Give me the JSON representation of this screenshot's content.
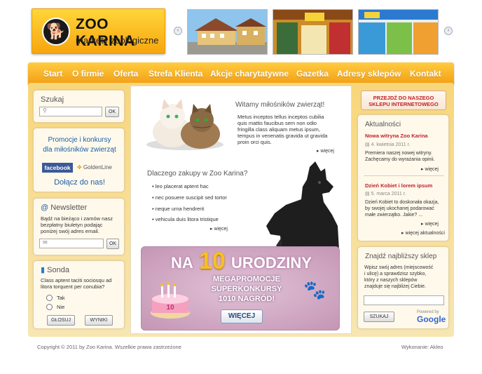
{
  "logo": {
    "name": "ZOO KARINA",
    "tagline": "markety zoologiczne"
  },
  "carousel": {
    "prev": "‹",
    "next": "›"
  },
  "nav": [
    "Start",
    "O firmie",
    "Oferta",
    "Strefa Klienta",
    "Akcje charytatywne",
    "Gazetka",
    "Adresy sklepów",
    "Kontakt"
  ],
  "search": {
    "title": "Szukaj",
    "button": "OK"
  },
  "promo": {
    "title_line1": "Promocje i konkursy",
    "title_line2": "dla miłośników zwierząt",
    "facebook": "facebook",
    "goldenline": "GoldenLine",
    "join": "Dołącz do nas!"
  },
  "newsletter": {
    "title": "Newsletter",
    "text_line1": "Bądź na bieżąco i zamów nasz",
    "text_line2": "bezpłatny biuletyn podając",
    "text_line3": "poniżej swój adres email.",
    "button": "OK"
  },
  "poll": {
    "title": "Sonda",
    "question_line1": "Class aptent taciti sociosqu ad",
    "question_line2": "litora torquent per conubia?",
    "option1": "Tak",
    "option2": "Nie",
    "vote": "GŁOSUJ",
    "results": "WYNIKI"
  },
  "welcome": {
    "title": "Witamy miłośników zwierząt!",
    "line1": "Metus inceptos tellus inceptos cubilia",
    "line2": "quis mattis faucibus sem non odio",
    "line3": "fringilla class aliquam metus ipsum,",
    "line4": "tempus in venenatis gravida ut gravida",
    "line5": "proin orci quis.",
    "more": "więcej"
  },
  "why": {
    "title": "Dlaczego zakupy w Zoo Karina?",
    "items": [
      "leo placerat aptent hac",
      "nec posuere suscipit sed tortor",
      "neque urna hendrerit",
      "vehicula duis litora tristique"
    ],
    "more": "więcej"
  },
  "banner": {
    "na": "NA",
    "num": "10",
    "urodziny": "URODZINY",
    "l1": "MEGAPROMOCJE",
    "l2": "SUPERKONKURSY",
    "l3": "1010 NAGRÓD!",
    "button": "WIĘCEJ",
    "cake_topper": "10"
  },
  "shop_btn": {
    "line1": "PRZEJDŹ DO NASZEGO",
    "line2": "SKLEPU INTERNETOWEGO"
  },
  "news": {
    "title": "Aktualności",
    "items": [
      {
        "title": "Nowa witryna Zoo Karina",
        "date": "4. kwietnia 2011 r.",
        "line1": "Premiera naszej nowej witryny.",
        "line2": "Zachęcamy do wyrażania opinii.",
        "more": "więcej"
      },
      {
        "title": "Dzień Kobiet i lorem ipsum",
        "date": "5. marca 2011 r.",
        "line1": "Dzień Kobiet to doskonała okazja,",
        "line2": "by swojej ukochanej podarować",
        "line3": "małe zwierzątko. Jakie? ...",
        "more": "więcej"
      }
    ],
    "all": "więcej aktualności"
  },
  "finder": {
    "title": "Znajdź najbliższy sklep",
    "line1": "Wpisz swój adres (miejscowość",
    "line2": "i ulicę) a sprawdzisz szybko,",
    "line3": "który z naszych sklepów",
    "line4": "znajduje się najbliżej Ciebie.",
    "button": "SZUKAJ",
    "powered": "Powered by",
    "google": "Google"
  },
  "footer": {
    "copyright": "Copyright © 2011 by Zoo Karina. Wszelkie prawa zastrzeżone",
    "credit": "Wykonanie: Akleo"
  },
  "colors": {
    "orange": "#f7a50e",
    "news_red": "#c0212b",
    "promo_blue": "#1a5fa6"
  }
}
